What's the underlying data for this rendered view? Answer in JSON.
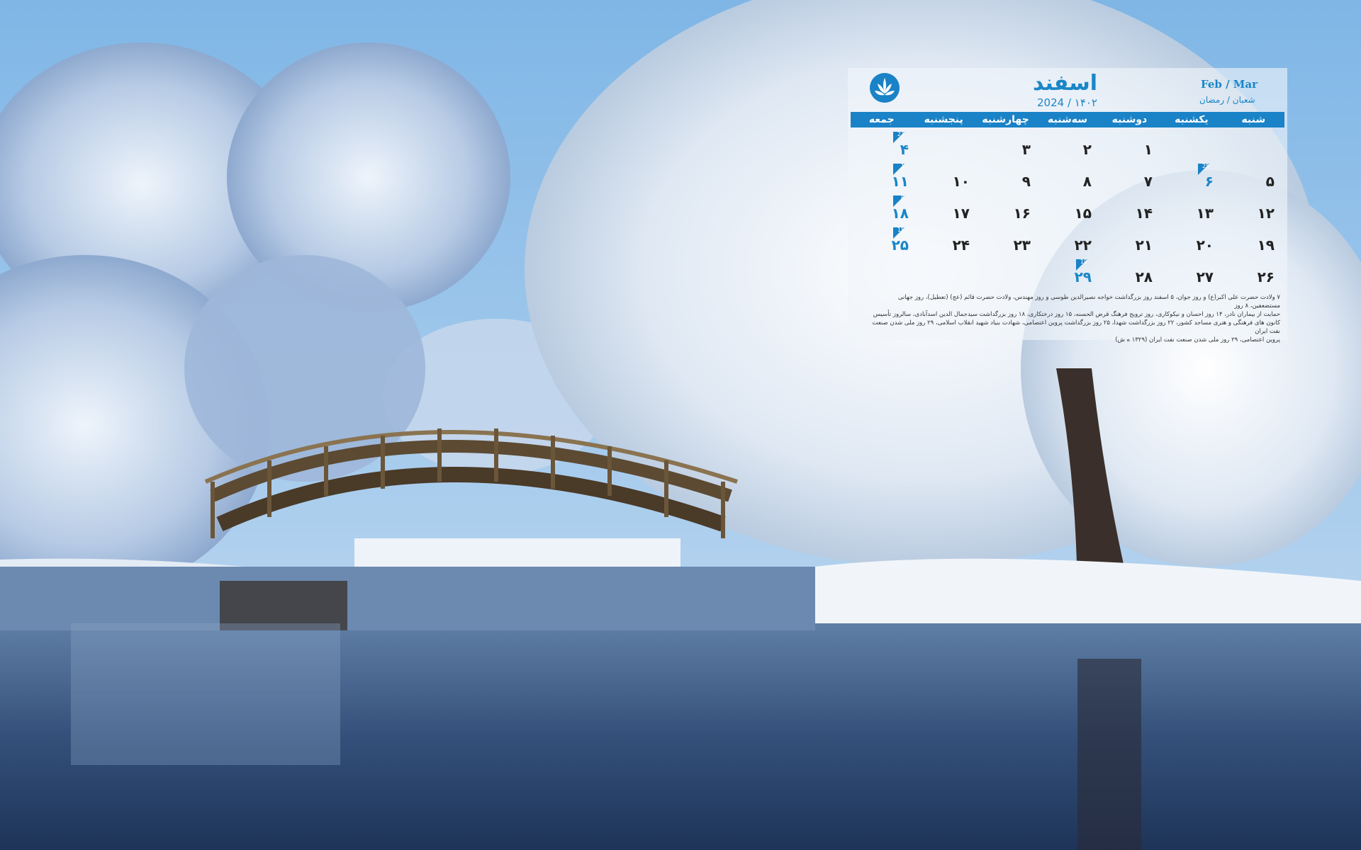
{
  "calendar": {
    "month_title": "اسفند",
    "year_line": "۱۴۰۲ / 2024",
    "gregorian_months": "Feb / Mar",
    "hijri_months": "شعبان / رمضان",
    "weekdays": [
      "شنبه",
      "یکشنبه",
      "دوشنبه",
      "سه‌شنبه",
      "چهارشنبه",
      "پنجشنبه",
      "جمعه"
    ],
    "rows": [
      [
        {
          "day": "",
          "sub": "",
          "holiday": false,
          "flag": ""
        },
        {
          "day": "",
          "sub": "",
          "holiday": false,
          "flag": ""
        },
        {
          "day": "۱",
          "sub": "",
          "holiday": false,
          "flag": ""
        },
        {
          "day": "۲",
          "sub": "",
          "holiday": false,
          "flag": ""
        },
        {
          "day": "۳",
          "sub": "",
          "holiday": false,
          "flag": ""
        },
        {
          "day": "",
          "sub": "",
          "holiday": false,
          "flag": ""
        },
        {
          "day": "۴",
          "sub": "",
          "holiday": true,
          "flag": "23"
        }
      ],
      [
        {
          "day": "۵",
          "sub": "",
          "holiday": false,
          "flag": ""
        },
        {
          "day": "۶",
          "sub": "",
          "holiday": true,
          "flag": "25"
        },
        {
          "day": "۷",
          "sub": "",
          "holiday": false,
          "flag": ""
        },
        {
          "day": "۸",
          "sub": "",
          "holiday": false,
          "flag": ""
        },
        {
          "day": "۹",
          "sub": "",
          "holiday": false,
          "flag": ""
        },
        {
          "day": "۱۰",
          "sub": "",
          "holiday": false,
          "flag": ""
        },
        {
          "day": "۱۱",
          "sub": "",
          "holiday": true,
          "flag": "1"
        }
      ],
      [
        {
          "day": "۱۲",
          "sub": "",
          "holiday": false,
          "flag": ""
        },
        {
          "day": "۱۳",
          "sub": "",
          "holiday": false,
          "flag": ""
        },
        {
          "day": "۱۴",
          "sub": "",
          "holiday": false,
          "flag": ""
        },
        {
          "day": "۱۵",
          "sub": "",
          "holiday": false,
          "flag": ""
        },
        {
          "day": "۱۶",
          "sub": "",
          "holiday": false,
          "flag": ""
        },
        {
          "day": "۱۷",
          "sub": "",
          "holiday": false,
          "flag": ""
        },
        {
          "day": "۱۸",
          "sub": "",
          "holiday": true,
          "flag": "8"
        }
      ],
      [
        {
          "day": "۱۹",
          "sub": "",
          "holiday": false,
          "flag": ""
        },
        {
          "day": "۲۰",
          "sub": "",
          "holiday": false,
          "flag": ""
        },
        {
          "day": "۲۱",
          "sub": "",
          "holiday": false,
          "flag": ""
        },
        {
          "day": "۲۲",
          "sub": "",
          "holiday": false,
          "flag": ""
        },
        {
          "day": "۲۳",
          "sub": "",
          "holiday": false,
          "flag": ""
        },
        {
          "day": "۲۴",
          "sub": "",
          "holiday": false,
          "flag": ""
        },
        {
          "day": "۲۵",
          "sub": "",
          "holiday": true,
          "flag": "15"
        }
      ],
      [
        {
          "day": "۲۶",
          "sub": "",
          "holiday": false,
          "flag": ""
        },
        {
          "day": "۲۷",
          "sub": "",
          "holiday": false,
          "flag": ""
        },
        {
          "day": "۲۸",
          "sub": "",
          "holiday": false,
          "flag": ""
        },
        {
          "day": "۲۹",
          "sub": "",
          "holiday": true,
          "flag": "19"
        },
        {
          "day": "",
          "sub": "",
          "holiday": false,
          "flag": ""
        },
        {
          "day": "",
          "sub": "",
          "holiday": false,
          "flag": ""
        },
        {
          "day": "",
          "sub": "",
          "holiday": false,
          "flag": ""
        }
      ]
    ],
    "events_line_1": "۷ ولادت حضرت علی اکبر(ع) و روز جوان، ۵ اسفند روز بزرگداشت خواجه نصیرالدین طوسی و روز مهندس، ولادت حضرت قائم (عج) (تعطیل)، روز جهانی مستضعفین، ۸ روز",
    "events_line_2": "حمایت از بیماران نادر، ۱۴ روز احسان و نیکوکاری، روز ترویج فرهنگ قرض الحسنه، ۱۵ روز درختکاری، ۱۸ روز بزرگداشت سیدجمال الدین اسدآبادی، سالروز تأسیس",
    "events_line_3": "کانون های فرهنگی و هنری مساجد کشور، ۲۲ روز بزرگداشت شهدا، ۲۵ روز بزرگداشت پروین اعتصامی، شهادت بنیاد شهید انقلاب اسلامی، ۲۹ روز ملی شدن صنعت نفت ایران",
    "events_line_4": "پروین اعتصامی، ۲۹ روز ملی شدن صنعت نفت ایران (۱۳۲۹ ه ش)"
  }
}
